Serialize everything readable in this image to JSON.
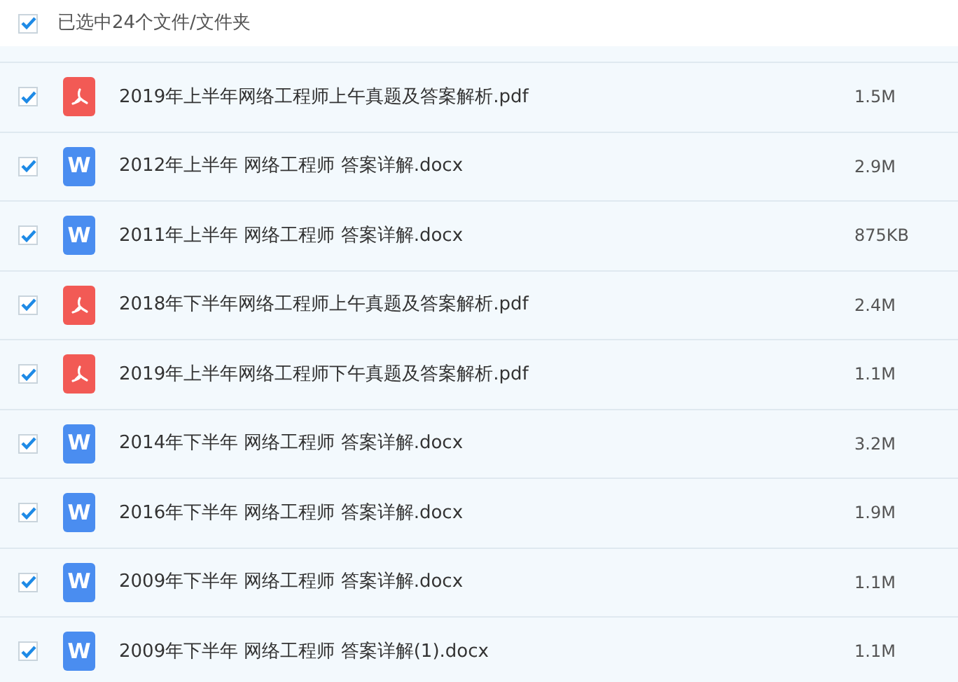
{
  "header": {
    "checked": true,
    "label": "已选中24个文件/文件夹"
  },
  "files": [
    {
      "kind": "pdf",
      "checked": true,
      "name": "2019年上半年网络工程师上午真题及答案解析.pdf",
      "size": "1.5M"
    },
    {
      "kind": "docx",
      "icon_text": "W",
      "checked": true,
      "name": "2012年上半年 网络工程师 答案详解.docx",
      "size": "2.9M"
    },
    {
      "kind": "docx",
      "icon_text": "W",
      "checked": true,
      "name": "2011年上半年 网络工程师 答案详解.docx",
      "size": "875KB"
    },
    {
      "kind": "pdf",
      "checked": true,
      "name": "2018年下半年网络工程师上午真题及答案解析.pdf",
      "size": "2.4M"
    },
    {
      "kind": "pdf",
      "checked": true,
      "name": "2019年上半年网络工程师下午真题及答案解析.pdf",
      "size": "1.1M"
    },
    {
      "kind": "docx",
      "icon_text": "W",
      "checked": true,
      "name": "2014年下半年 网络工程师 答案详解.docx",
      "size": "3.2M"
    },
    {
      "kind": "docx",
      "icon_text": "W",
      "checked": true,
      "name": "2016年下半年 网络工程师 答案详解.docx",
      "size": "1.9M"
    },
    {
      "kind": "docx",
      "icon_text": "W",
      "checked": true,
      "name": "2009年下半年 网络工程师 答案详解.docx",
      "size": "1.1M"
    },
    {
      "kind": "docx",
      "icon_text": "W",
      "checked": true,
      "name": "2009年下半年 网络工程师 答案详解(1).docx",
      "size": "1.1M"
    }
  ]
}
